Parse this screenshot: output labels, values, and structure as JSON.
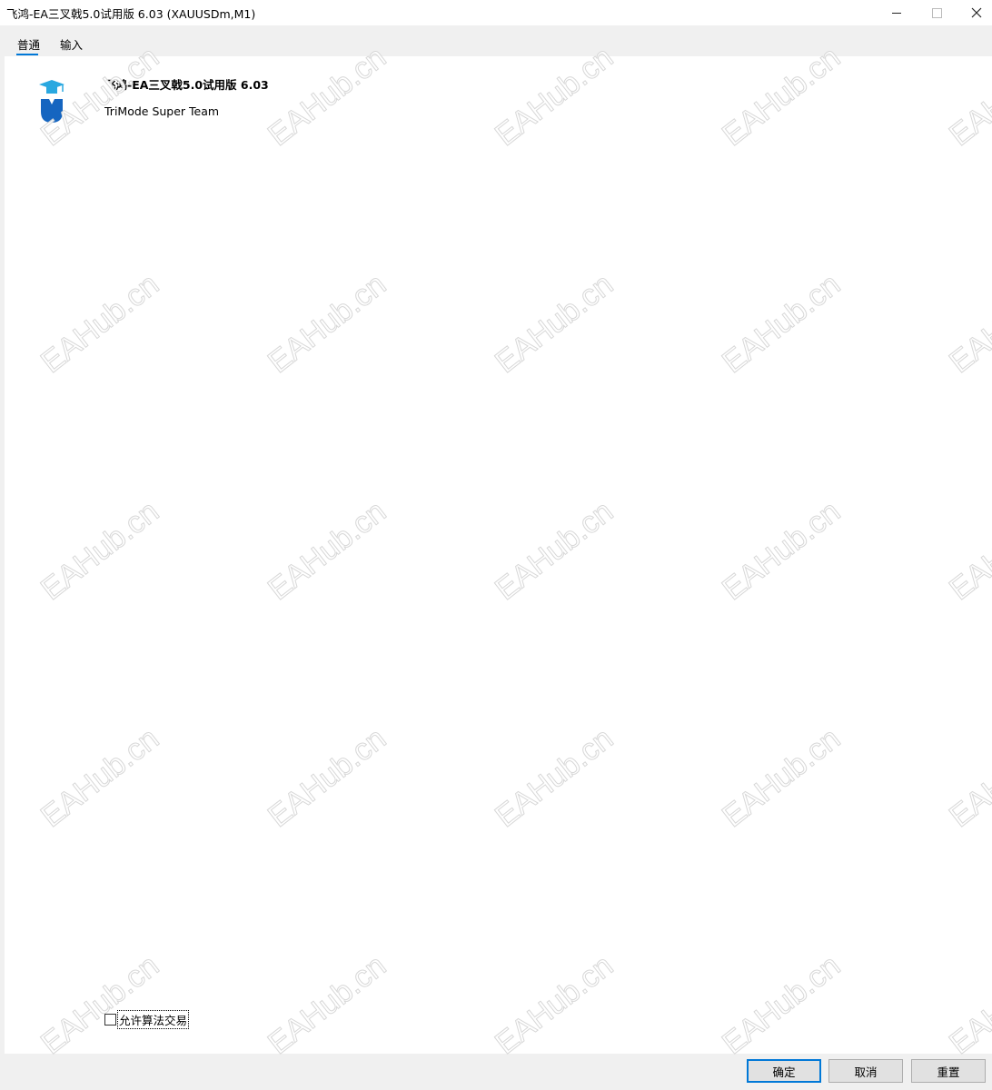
{
  "window": {
    "title": "飞鸿-EA三叉戟5.0试用版 6.03 (XAUUSDm,M1)"
  },
  "tabs": [
    {
      "label": "普通",
      "active": true
    },
    {
      "label": "输入",
      "active": false
    }
  ],
  "ea": {
    "name": "飞鸿-EA三叉戟5.0试用版 6.03",
    "author": "TriMode Super Team",
    "logo_icon": "graduation-cap-shield-icon"
  },
  "options": {
    "algo_trading_label": "允许算法交易",
    "algo_trading_checked": false
  },
  "buttons": {
    "ok": "确定",
    "cancel": "取消",
    "reset": "重置"
  },
  "watermark": {
    "text": "EAHub.cn"
  },
  "colors": {
    "accent": "#0078d7",
    "logo_blue": "#1565c0",
    "logo_light": "#29a8e0"
  }
}
